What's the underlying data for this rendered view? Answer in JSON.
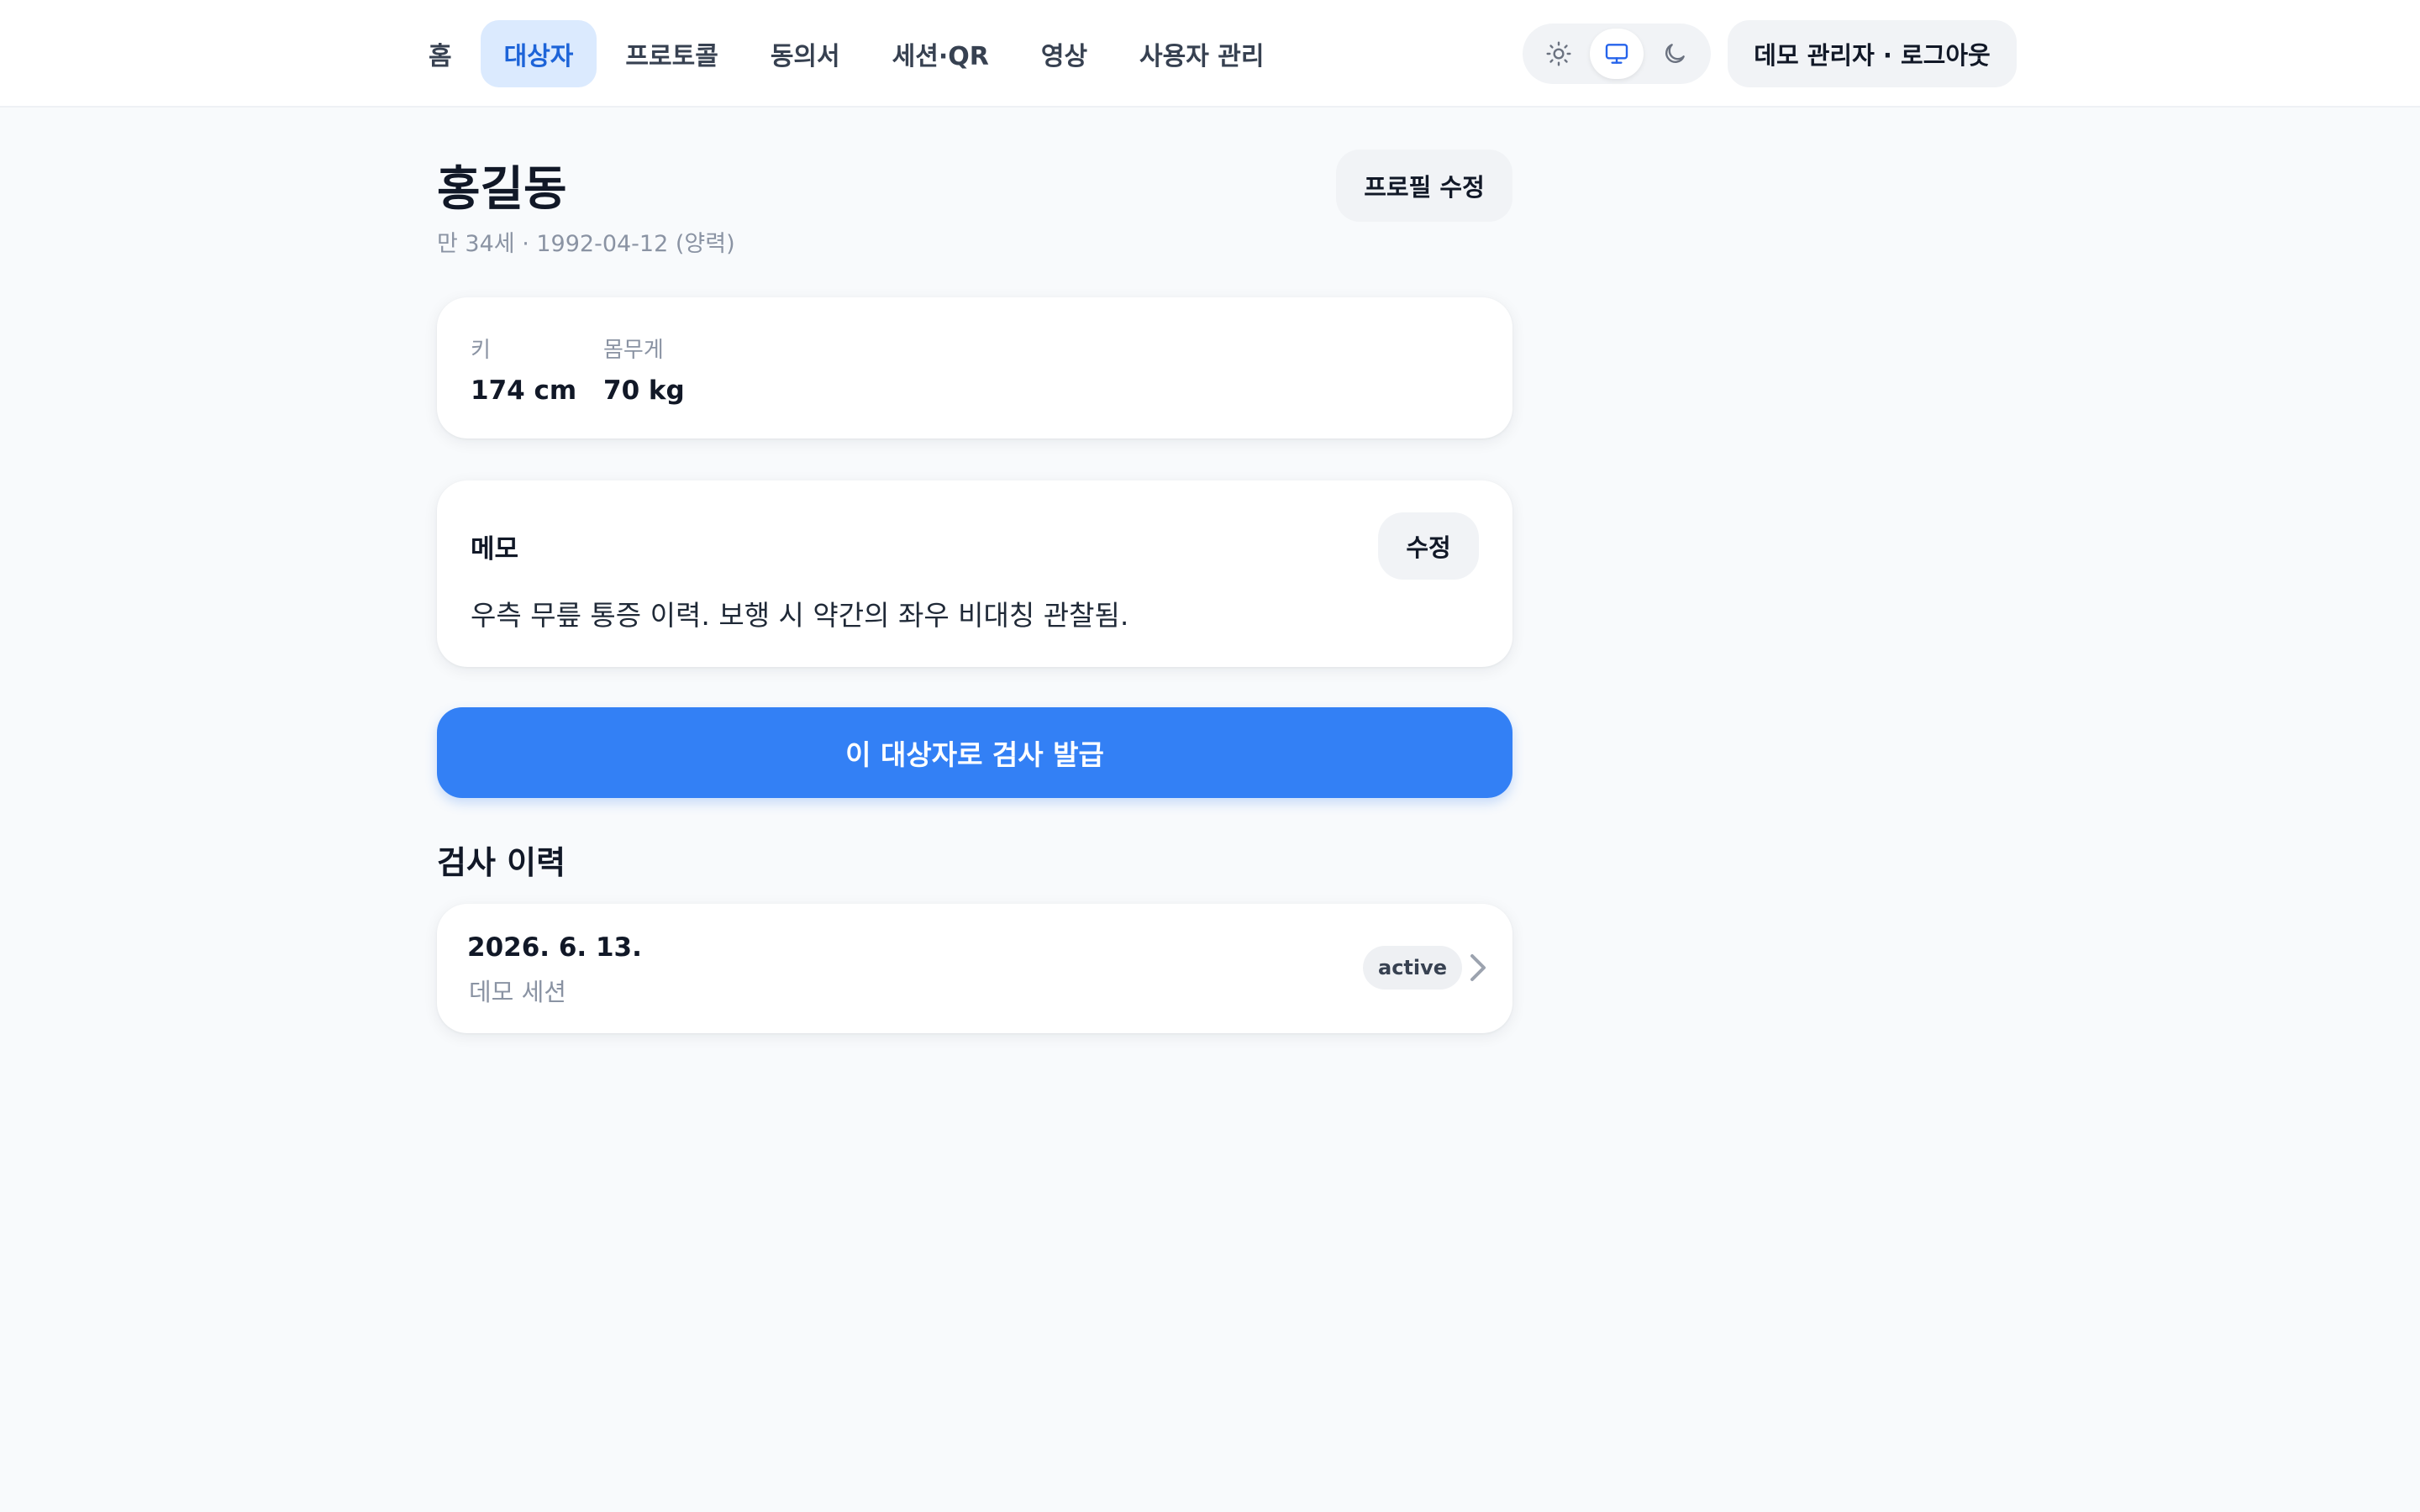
{
  "nav": {
    "items": [
      {
        "label": "홈"
      },
      {
        "label": "대상자"
      },
      {
        "label": "프로토콜"
      },
      {
        "label": "동의서"
      },
      {
        "label": "세션·QR"
      },
      {
        "label": "영상"
      },
      {
        "label": "사용자 관리"
      }
    ],
    "active_index": 1
  },
  "theme": {
    "options": [
      "sun-icon",
      "monitor-icon",
      "moon-icon"
    ],
    "selected": "monitor-icon"
  },
  "account": {
    "label": "데모 관리자 · 로그아웃"
  },
  "subject": {
    "name": "홍길동",
    "info": "만 34세 · 1992-04-12 (양력)",
    "edit_label": "프로필 수정"
  },
  "metrics": [
    {
      "label": "키",
      "value": "174 cm"
    },
    {
      "label": "몸무게",
      "value": "70 kg"
    }
  ],
  "memo": {
    "title": "메모",
    "edit_label": "수정",
    "text": "우측 무릎 통증 이력. 보행 시 약간의 좌우 비대칭 관찰됨."
  },
  "primary_action": {
    "label": "이 대상자로 검사 발급"
  },
  "history": {
    "title": "검사 이력",
    "items": [
      {
        "date": "2026. 6. 13.",
        "description": "데모 세션",
        "status": "active"
      }
    ]
  },
  "colors": {
    "accent": "#3380f5",
    "nav_active_bg": "#dbeafe",
    "nav_active_text": "#1d64d8",
    "background": "#f8fafc"
  }
}
